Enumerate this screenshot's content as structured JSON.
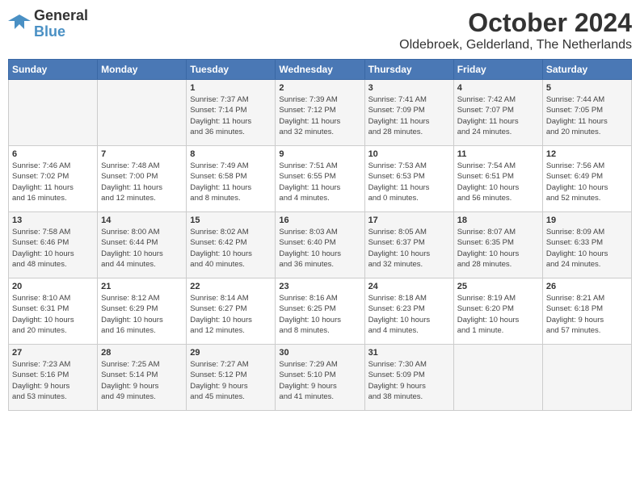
{
  "logo": {
    "line1": "General",
    "line2": "Blue"
  },
  "title": "October 2024",
  "subtitle": "Oldebroek, Gelderland, The Netherlands",
  "days_of_week": [
    "Sunday",
    "Monday",
    "Tuesday",
    "Wednesday",
    "Thursday",
    "Friday",
    "Saturday"
  ],
  "weeks": [
    [
      {
        "day": "",
        "info": ""
      },
      {
        "day": "",
        "info": ""
      },
      {
        "day": "1",
        "info": "Sunrise: 7:37 AM\nSunset: 7:14 PM\nDaylight: 11 hours\nand 36 minutes."
      },
      {
        "day": "2",
        "info": "Sunrise: 7:39 AM\nSunset: 7:12 PM\nDaylight: 11 hours\nand 32 minutes."
      },
      {
        "day": "3",
        "info": "Sunrise: 7:41 AM\nSunset: 7:09 PM\nDaylight: 11 hours\nand 28 minutes."
      },
      {
        "day": "4",
        "info": "Sunrise: 7:42 AM\nSunset: 7:07 PM\nDaylight: 11 hours\nand 24 minutes."
      },
      {
        "day": "5",
        "info": "Sunrise: 7:44 AM\nSunset: 7:05 PM\nDaylight: 11 hours\nand 20 minutes."
      }
    ],
    [
      {
        "day": "6",
        "info": "Sunrise: 7:46 AM\nSunset: 7:02 PM\nDaylight: 11 hours\nand 16 minutes."
      },
      {
        "day": "7",
        "info": "Sunrise: 7:48 AM\nSunset: 7:00 PM\nDaylight: 11 hours\nand 12 minutes."
      },
      {
        "day": "8",
        "info": "Sunrise: 7:49 AM\nSunset: 6:58 PM\nDaylight: 11 hours\nand 8 minutes."
      },
      {
        "day": "9",
        "info": "Sunrise: 7:51 AM\nSunset: 6:55 PM\nDaylight: 11 hours\nand 4 minutes."
      },
      {
        "day": "10",
        "info": "Sunrise: 7:53 AM\nSunset: 6:53 PM\nDaylight: 11 hours\nand 0 minutes."
      },
      {
        "day": "11",
        "info": "Sunrise: 7:54 AM\nSunset: 6:51 PM\nDaylight: 10 hours\nand 56 minutes."
      },
      {
        "day": "12",
        "info": "Sunrise: 7:56 AM\nSunset: 6:49 PM\nDaylight: 10 hours\nand 52 minutes."
      }
    ],
    [
      {
        "day": "13",
        "info": "Sunrise: 7:58 AM\nSunset: 6:46 PM\nDaylight: 10 hours\nand 48 minutes."
      },
      {
        "day": "14",
        "info": "Sunrise: 8:00 AM\nSunset: 6:44 PM\nDaylight: 10 hours\nand 44 minutes."
      },
      {
        "day": "15",
        "info": "Sunrise: 8:02 AM\nSunset: 6:42 PM\nDaylight: 10 hours\nand 40 minutes."
      },
      {
        "day": "16",
        "info": "Sunrise: 8:03 AM\nSunset: 6:40 PM\nDaylight: 10 hours\nand 36 minutes."
      },
      {
        "day": "17",
        "info": "Sunrise: 8:05 AM\nSunset: 6:37 PM\nDaylight: 10 hours\nand 32 minutes."
      },
      {
        "day": "18",
        "info": "Sunrise: 8:07 AM\nSunset: 6:35 PM\nDaylight: 10 hours\nand 28 minutes."
      },
      {
        "day": "19",
        "info": "Sunrise: 8:09 AM\nSunset: 6:33 PM\nDaylight: 10 hours\nand 24 minutes."
      }
    ],
    [
      {
        "day": "20",
        "info": "Sunrise: 8:10 AM\nSunset: 6:31 PM\nDaylight: 10 hours\nand 20 minutes."
      },
      {
        "day": "21",
        "info": "Sunrise: 8:12 AM\nSunset: 6:29 PM\nDaylight: 10 hours\nand 16 minutes."
      },
      {
        "day": "22",
        "info": "Sunrise: 8:14 AM\nSunset: 6:27 PM\nDaylight: 10 hours\nand 12 minutes."
      },
      {
        "day": "23",
        "info": "Sunrise: 8:16 AM\nSunset: 6:25 PM\nDaylight: 10 hours\nand 8 minutes."
      },
      {
        "day": "24",
        "info": "Sunrise: 8:18 AM\nSunset: 6:23 PM\nDaylight: 10 hours\nand 4 minutes."
      },
      {
        "day": "25",
        "info": "Sunrise: 8:19 AM\nSunset: 6:20 PM\nDaylight: 10 hours\nand 1 minute."
      },
      {
        "day": "26",
        "info": "Sunrise: 8:21 AM\nSunset: 6:18 PM\nDaylight: 9 hours\nand 57 minutes."
      }
    ],
    [
      {
        "day": "27",
        "info": "Sunrise: 7:23 AM\nSunset: 5:16 PM\nDaylight: 9 hours\nand 53 minutes."
      },
      {
        "day": "28",
        "info": "Sunrise: 7:25 AM\nSunset: 5:14 PM\nDaylight: 9 hours\nand 49 minutes."
      },
      {
        "day": "29",
        "info": "Sunrise: 7:27 AM\nSunset: 5:12 PM\nDaylight: 9 hours\nand 45 minutes."
      },
      {
        "day": "30",
        "info": "Sunrise: 7:29 AM\nSunset: 5:10 PM\nDaylight: 9 hours\nand 41 minutes."
      },
      {
        "day": "31",
        "info": "Sunrise: 7:30 AM\nSunset: 5:09 PM\nDaylight: 9 hours\nand 38 minutes."
      },
      {
        "day": "",
        "info": ""
      },
      {
        "day": "",
        "info": ""
      }
    ]
  ]
}
